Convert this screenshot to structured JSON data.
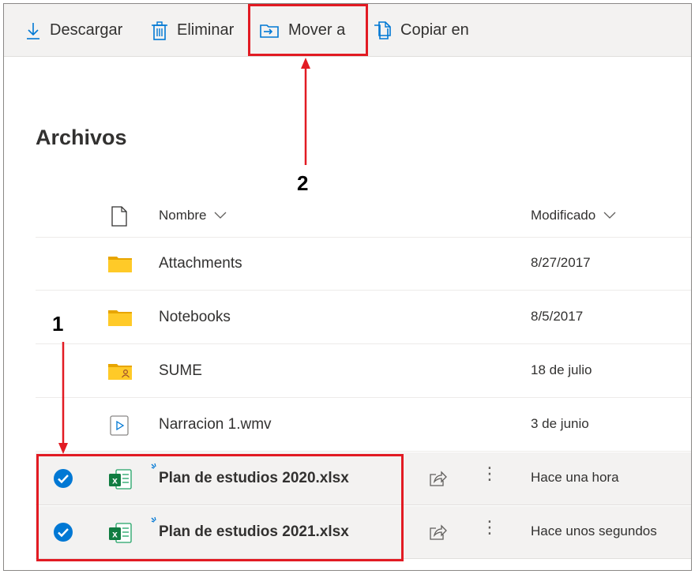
{
  "toolbar": {
    "download_label": "Descargar",
    "delete_label": "Eliminar",
    "move_label": "Mover a",
    "copy_label": "Copiar en"
  },
  "page_title": "Archivos",
  "columns": {
    "name": "Nombre",
    "modified": "Modificado"
  },
  "files": [
    {
      "name": "Attachments",
      "modified": "8/27/2017",
      "type": "folder",
      "selected": false
    },
    {
      "name": "Notebooks",
      "modified": "8/5/2017",
      "type": "folder",
      "selected": false
    },
    {
      "name": "SUME",
      "modified": "18 de julio",
      "type": "shared-folder",
      "selected": false
    },
    {
      "name": "Narracion 1.wmv",
      "modified": "3 de junio",
      "type": "video",
      "selected": false
    },
    {
      "name": "Plan de estudios 2020.xlsx",
      "modified": "Hace una hora",
      "type": "excel",
      "selected": true
    },
    {
      "name": "Plan de estudios 2021.xlsx",
      "modified": "Hace unos segundos",
      "type": "excel",
      "selected": true
    }
  ],
  "annotations": {
    "step_1": "1",
    "step_2": "2"
  },
  "colors": {
    "accent": "#0078d4",
    "highlight": "#e21b23",
    "folder": "#ffb900",
    "excel": "#217346",
    "selected_row": "#f3f2f1"
  },
  "icons": [
    "download-icon",
    "trash-icon",
    "move-to-icon",
    "copy-icon",
    "file-icon",
    "chevron-down-icon",
    "folder-icon",
    "shared-folder-icon",
    "video-icon",
    "excel-icon",
    "checkmark-icon",
    "share-icon",
    "more-icon"
  ]
}
